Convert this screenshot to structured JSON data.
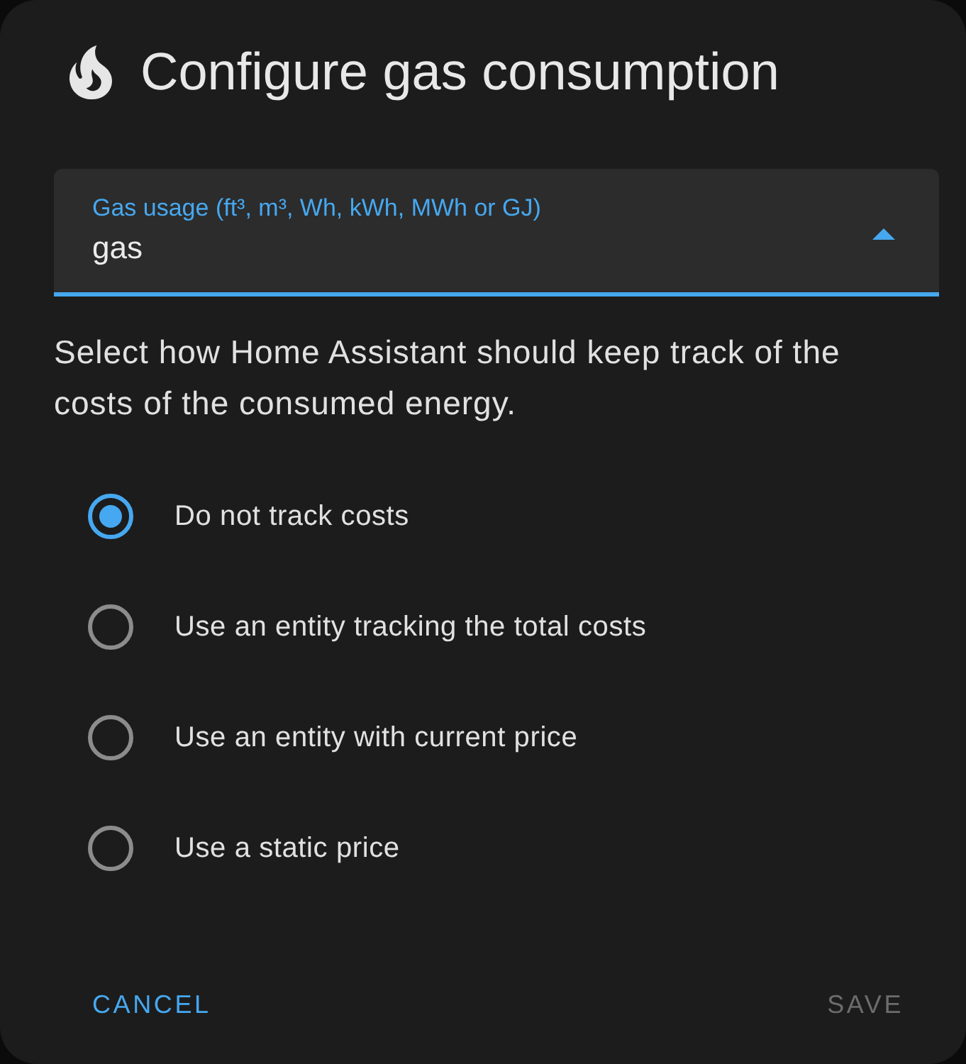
{
  "dialog": {
    "title": "Configure gas consumption"
  },
  "gas_usage_select": {
    "label": "Gas usage (ft³, m³, Wh, kWh, MWh or GJ)",
    "value": "gas",
    "focused": true,
    "expanded": true
  },
  "description": "Select how Home Assistant should keep track of the costs of the consumed energy.",
  "cost_options": [
    {
      "label": "Do not track costs",
      "selected": true
    },
    {
      "label": "Use an entity tracking the total costs",
      "selected": false
    },
    {
      "label": "Use an entity with current price",
      "selected": false
    },
    {
      "label": "Use a static price",
      "selected": false
    }
  ],
  "buttons": [
    {
      "label": "CANCEL",
      "disabled": false
    },
    {
      "label": "SAVE",
      "disabled": true
    }
  ]
}
